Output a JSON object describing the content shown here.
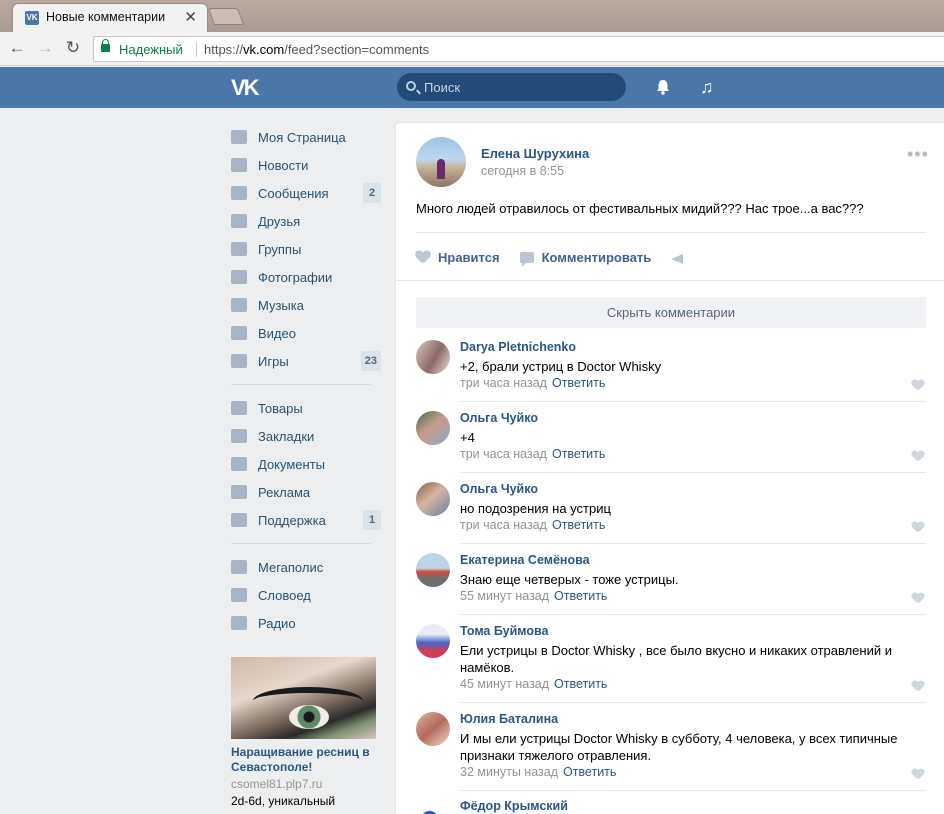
{
  "browser": {
    "tab_title": "Новые комментарии",
    "tab_close": "✕",
    "secure_label": "Надежный",
    "url_scheme": "https://",
    "url_host": "vk.com",
    "url_path": "/feed?section=comments"
  },
  "header": {
    "logo": "VK",
    "search_placeholder": "Поиск"
  },
  "sidebar": {
    "items": [
      {
        "label": "Моя Страница",
        "icon": "home-icon"
      },
      {
        "label": "Новости",
        "icon": "news-icon"
      },
      {
        "label": "Сообщения",
        "icon": "messages-icon",
        "count": "2"
      },
      {
        "label": "Друзья",
        "icon": "friends-icon"
      },
      {
        "label": "Группы",
        "icon": "groups-icon"
      },
      {
        "label": "Фотографии",
        "icon": "camera-icon"
      },
      {
        "label": "Музыка",
        "icon": "music-icon"
      },
      {
        "label": "Видео",
        "icon": "video-icon"
      },
      {
        "label": "Игры",
        "icon": "gamepad-icon",
        "count": "23"
      }
    ],
    "items2": [
      {
        "label": "Товары",
        "icon": "bag-icon"
      },
      {
        "label": "Закладки",
        "icon": "star-icon"
      },
      {
        "label": "Документы",
        "icon": "document-icon"
      },
      {
        "label": "Реклама",
        "icon": "megaphone-icon"
      },
      {
        "label": "Поддержка",
        "icon": "lifebuoy-icon",
        "count": "1"
      }
    ],
    "items3": [
      {
        "label": "Мегаполис",
        "icon": "database-icon"
      },
      {
        "label": "Словоед",
        "icon": "flask-icon"
      },
      {
        "label": "Радио",
        "icon": "grid-icon"
      }
    ],
    "ad": {
      "title": "Наращивание ресниц в Севастополе!",
      "domain": "csomel81.plp7.ru",
      "desc": "2d-6d, уникальный"
    }
  },
  "post": {
    "author": "Елена Шурухина",
    "time": "сегодня в 8:55",
    "more": "•••",
    "text": "Много людей отравилось от фестивальных мидий??? Нас трое...а вас???",
    "like_label": "Нравится",
    "comment_label": "Комментировать",
    "hide_comments": "Скрыть комментарии"
  },
  "comments": [
    {
      "author": "Darya Pletnichenko",
      "text": "+2, брали устриц в Doctor Whisky",
      "time": "три часа назад",
      "reply": "Ответить"
    },
    {
      "author": "Ольга Чуйко",
      "text": "+4",
      "time": "три часа назад",
      "reply": "Ответить"
    },
    {
      "author": "Ольга Чуйко",
      "text": "но подозрения на устриц",
      "time": "три часа назад",
      "reply": "Ответить"
    },
    {
      "author": "Екатерина Семёнова",
      "text": "Знаю еще четверых - тоже устрицы.",
      "time": "55 минут назад",
      "reply": "Ответить"
    },
    {
      "author": "Тома Буймова",
      "text": "Ели устрицы в Doctor Whisky , все было вкусно и никаких отравлений и намёков.",
      "time": "45 минут назад",
      "reply": "Ответить"
    },
    {
      "author": "Юлия Баталина",
      "text": "И мы ели устрицы Doctor Whisky в субботу, 4 человека, у всех типичные признаки тяжелого отравления.",
      "time": "32 минуты назад",
      "reply": "Ответить"
    },
    {
      "author": "Фёдор Крымский"
    }
  ]
}
